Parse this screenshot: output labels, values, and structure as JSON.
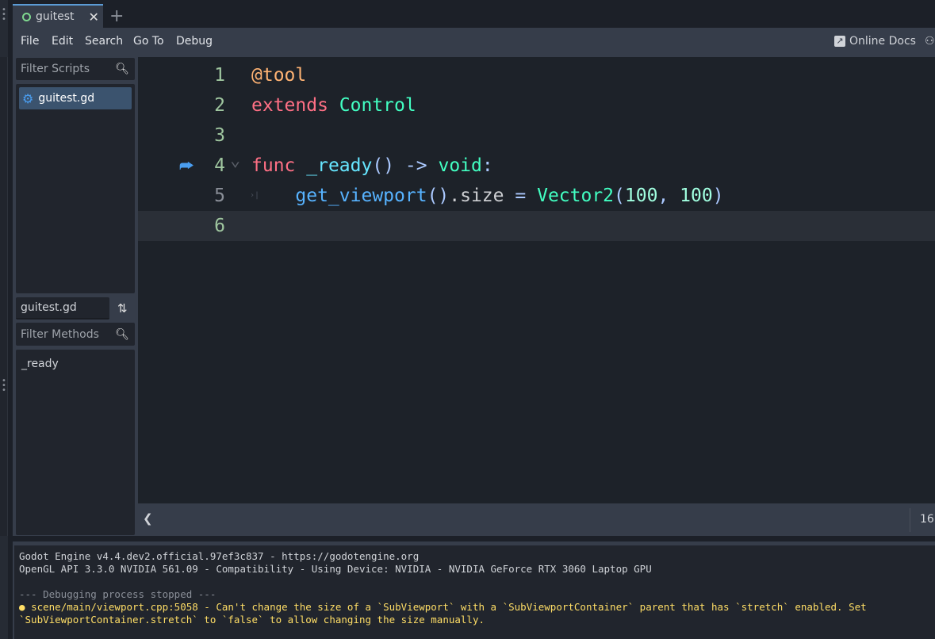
{
  "tab": {
    "title": "guitest",
    "close": "✕",
    "add": "+"
  },
  "menu": [
    "File",
    "Edit",
    "Search",
    "Go To",
    "Debug"
  ],
  "online_docs": "Online Docs",
  "scripts": {
    "filter_placeholder": "Filter Scripts",
    "items": [
      "guitest.gd"
    ]
  },
  "methods": {
    "current_script": "guitest.gd",
    "filter_placeholder": "Filter Methods",
    "items": [
      "_ready"
    ]
  },
  "code": {
    "lines": [
      [
        {
          "t": "@tool",
          "c": "#ffb373"
        }
      ],
      [
        {
          "t": "extends",
          "c": "#ff7085"
        },
        {
          "t": " "
        },
        {
          "t": "Control",
          "c": "#42ffc2"
        }
      ],
      [],
      [
        {
          "t": "func",
          "c": "#ff7085"
        },
        {
          "t": " "
        },
        {
          "t": "_ready",
          "c": "#66e6ff"
        },
        {
          "t": "()",
          "c": "#abc9ff"
        },
        {
          "t": " "
        },
        {
          "t": "->",
          "c": "#abc9ff"
        },
        {
          "t": " "
        },
        {
          "t": "void",
          "c": "#42ffc2"
        },
        {
          "t": ":",
          "c": "#abc9ff"
        }
      ],
      [
        {
          "t": "    "
        },
        {
          "t": "get_viewport",
          "c": "#57b3ff"
        },
        {
          "t": "()",
          "c": "#abc9ff"
        },
        {
          "t": ".size",
          "c": "#cdcfd2"
        },
        {
          "t": " "
        },
        {
          "t": "=",
          "c": "#abc9ff"
        },
        {
          "t": " "
        },
        {
          "t": "Vector2",
          "c": "#42ffc2"
        },
        {
          "t": "(",
          "c": "#abc9ff"
        },
        {
          "t": "100",
          "c": "#a1ffe0"
        },
        {
          "t": ", ",
          "c": "#abc9ff"
        },
        {
          "t": "100",
          "c": "#a1ffe0"
        },
        {
          "t": ")",
          "c": "#abc9ff"
        }
      ],
      []
    ],
    "current_line": 6
  },
  "status": {
    "scroll_left": "❮",
    "position": "16"
  },
  "output": {
    "lines": [
      {
        "t": "Godot Engine v4.4.dev2.official.97ef3c837 - https://godotengine.org",
        "c": "#d0d3d8"
      },
      {
        "t": "OpenGL API 3.3.0 NVIDIA 561.09 - Compatibility - Using Device: NVIDIA - NVIDIA GeForce RTX 3060 Laptop GPU",
        "c": "#d0d3d8"
      },
      {
        "t": "",
        "c": "#d0d3d8"
      },
      {
        "t": "--- Debugging process stopped ---",
        "c": "#8a8f98"
      },
      {
        "t": "scene/main/viewport.cpp:5058 - Can't change the size of a `SubViewport` with a `SubViewportContainer` parent that has `stretch` enabled. Set",
        "c": "#ffde66",
        "bullet": "●"
      },
      {
        "t": "`SubViewportContainer.stretch` to `false` to allow changing the size manually.",
        "c": "#ffde66"
      }
    ]
  }
}
